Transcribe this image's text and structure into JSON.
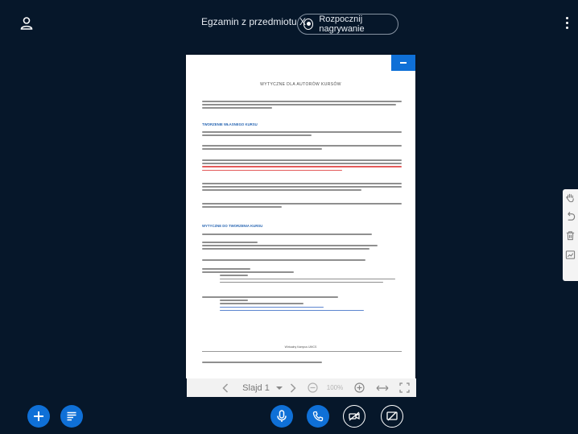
{
  "header": {
    "title": "Egzamin z przedmiotu X",
    "record_label": "Rozpocznij nagrywanie"
  },
  "slide": {
    "title": "WYTYCZNE DLA AUTORÓW KURSÓW",
    "heading_1": "TWORZENIE WŁASNEGO KURSU",
    "heading_2": "WYTYCZNE DO TWORZENIA KURSU",
    "footer": "Wirtualny Kampus UMCS"
  },
  "toolbar": {
    "slide_label": "Slajd 1",
    "zoom": "100%"
  },
  "colors": {
    "background": "#06172a",
    "accent": "#0f70d7"
  },
  "icons": {
    "user": "user-icon",
    "record": "record-icon",
    "more": "kebab-icon",
    "minimize": "minus-icon",
    "hand": "hand-icon",
    "undo": "undo-icon",
    "trash": "trash-icon",
    "whiteboard": "whiteboard-icon",
    "plus": "plus-icon",
    "chat": "chat-list-icon",
    "microphone": "microphone-icon",
    "phone": "phone-icon",
    "camera_off": "camera-off-icon",
    "screen_share_off": "screen-share-off-icon"
  }
}
